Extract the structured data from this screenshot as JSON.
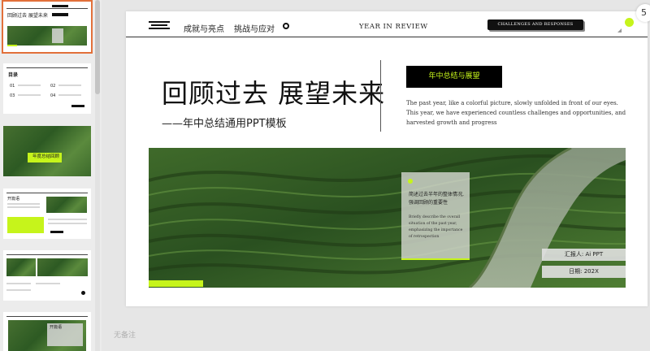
{
  "slide": {
    "nav": {
      "item1": "成就与亮点",
      "item2": "挑战与应对"
    },
    "year_in_review": "YEAR IN REVIEW",
    "challenge_button": "CHALLENGES AND RESPONSES",
    "title": "回顾过去 展望未来",
    "subtitle": "——年中总结通用PPT模板",
    "badge": "年中总结与展望",
    "description": "The past year, like a colorful picture, slowly unfolded in front of our eyes. This year, we have experienced countless challenges and opportunities, and harvested growth and progress",
    "card": {
      "cn": "简述过去半年的整体情况,强调回顾的重要性",
      "en": "Briefly describe the overall situation of the past year, emphasizing the importance of retrospection"
    },
    "reporter": "汇报人: Ai PPT",
    "date": "日期: 202X"
  },
  "thumbnails": {
    "t1_title": "回顾过去 展望未来",
    "t2_title": "目录",
    "t2_items": [
      "01",
      "02",
      "03",
      "04"
    ],
    "t3_label": "年度总结回顾",
    "t4_label": "开篇语",
    "t6_label": "开篇语"
  },
  "top_badge": "5",
  "notes_placeholder": "无备注",
  "colors": {
    "accent": "#c6f41b",
    "dark": "#111111",
    "selection": "#e2703a"
  }
}
